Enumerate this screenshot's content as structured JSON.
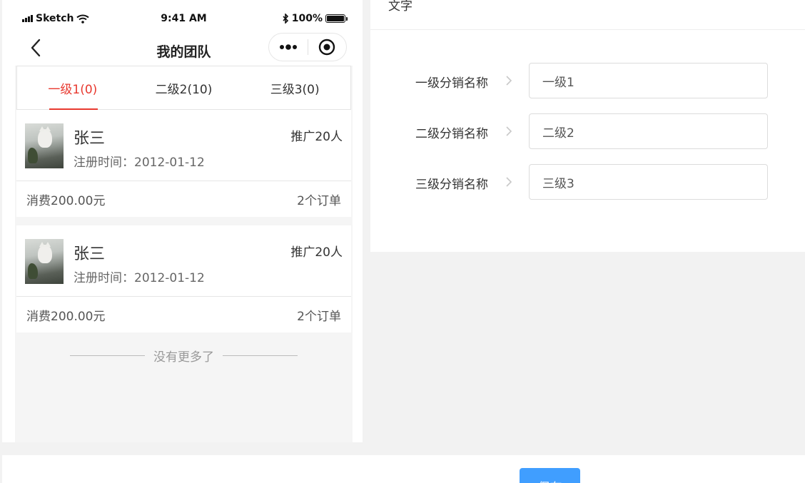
{
  "phone": {
    "status_bar": {
      "carrier": "Sketch",
      "time": "9:41 AM",
      "battery": "100%"
    },
    "nav": {
      "title": "我的团队"
    },
    "tabs": [
      {
        "label": "一级1(0)",
        "active": true
      },
      {
        "label": "二级2(10)",
        "active": false
      },
      {
        "label": "三级3(0)",
        "active": false
      }
    ],
    "members": [
      {
        "name": "张三",
        "register": "注册时间：2012-01-12",
        "promo": "推广20人",
        "spend": "消费200.00元",
        "orders": "2个订单"
      },
      {
        "name": "张三",
        "register": "注册时间：2012-01-12",
        "promo": "推广20人",
        "spend": "消费200.00元",
        "orders": "2个订单"
      }
    ],
    "no_more": "没有更多了"
  },
  "settings": {
    "header": "文字",
    "rows": [
      {
        "label": "一级分销名称",
        "value": "一级1"
      },
      {
        "label": "二级分销名称",
        "value": "二级2"
      },
      {
        "label": "三级分销名称",
        "value": "三级3"
      }
    ]
  },
  "footer": {
    "save_label": "保存"
  },
  "colors": {
    "accent_red": "#e8392f",
    "primary_blue": "#409eff"
  }
}
